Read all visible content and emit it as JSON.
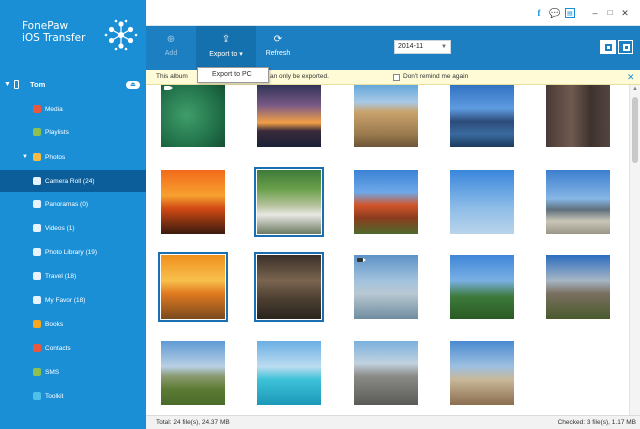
{
  "app": {
    "brand_line1": "FonePaw",
    "brand_line2": "iOS Transfer"
  },
  "device": {
    "name": "Tom"
  },
  "sidebar": {
    "items": [
      {
        "label": "Media",
        "icon": "media-icon",
        "color": "#e9573f"
      },
      {
        "label": "Playlists",
        "icon": "playlist-icon",
        "color": "#8cc152"
      },
      {
        "label": "Photos",
        "icon": "photos-icon",
        "color": "#f6bb42"
      },
      {
        "label": "Camera Roll (24)",
        "icon": "camera-roll-icon"
      },
      {
        "label": "Panoramas (0)",
        "icon": "panorama-icon"
      },
      {
        "label": "Videos (1)",
        "icon": "videos-icon"
      },
      {
        "label": "Photo Library (19)",
        "icon": "photo-library-icon"
      },
      {
        "label": "Travel (18)",
        "icon": "album-icon"
      },
      {
        "label": "My Favor (18)",
        "icon": "album-icon"
      },
      {
        "label": "Books",
        "icon": "books-icon",
        "color": "#f6a623"
      },
      {
        "label": "Contacts",
        "icon": "contacts-icon",
        "color": "#e9573f"
      },
      {
        "label": "SMS",
        "icon": "sms-icon",
        "color": "#8cc152"
      },
      {
        "label": "Toolkit",
        "icon": "toolkit-icon",
        "color": "#4fc1e9"
      }
    ],
    "active": "Camera Roll (24)"
  },
  "toolbar": {
    "add_label": "Add",
    "export_label": "Export to",
    "refresh_label": "Refresh",
    "date_value": "2014-11"
  },
  "dropdown": {
    "export_to_pc": "Export to PC"
  },
  "notice": {
    "part1": "This album",
    "part2": "an only be exported.",
    "checkbox_label": "Don't remind me again"
  },
  "status": {
    "total": "Total: 24 file(s), 24.37 MB",
    "checked": "Checked: 3 file(s), 1.17 MB"
  },
  "colors": {
    "sidebar": "#1a8fd6",
    "toolbar": "#1b7fc2",
    "selection": "#1b6fb0"
  }
}
